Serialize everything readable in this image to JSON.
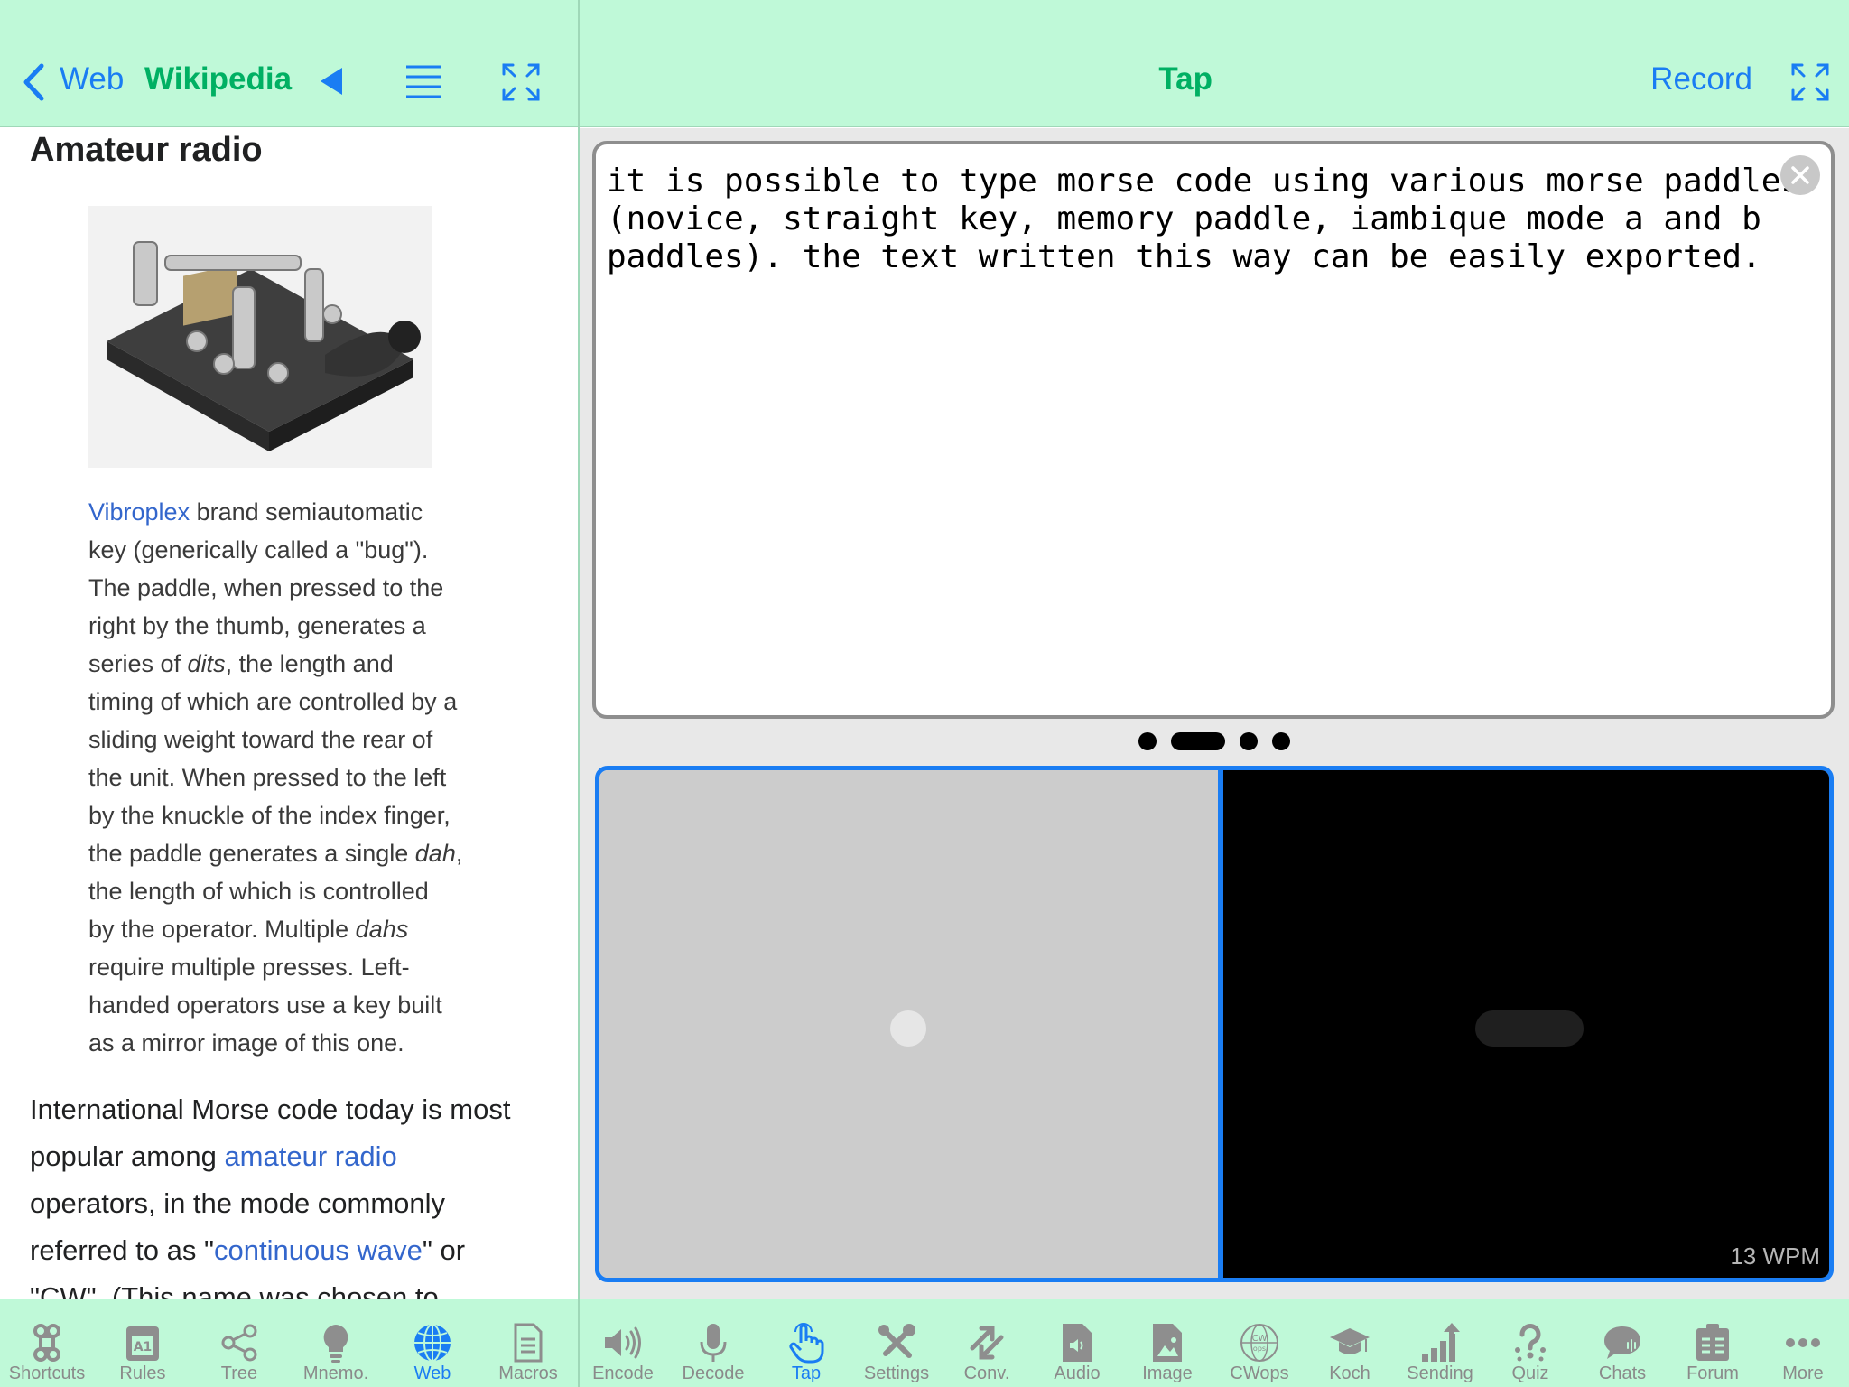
{
  "left_nav": {
    "back_label": "Web",
    "title": "Wikipedia"
  },
  "right_nav": {
    "title": "Tap",
    "record_label": "Record"
  },
  "article": {
    "heading": "Amateur radio",
    "caption_lines": [
      [
        "Vibroplex",
        " brand semiautomatic"
      ],
      [
        "key (generically called a \"bug\")."
      ],
      [
        "The paddle, when pressed to the"
      ],
      [
        "right by the thumb, generates a"
      ],
      [
        "series of ",
        "dits",
        ", the length and"
      ],
      [
        "timing of which are controlled by a"
      ],
      [
        "sliding weight toward the rear of"
      ],
      [
        "the unit. When pressed to the left"
      ],
      [
        "by the knuckle of the index finger,"
      ],
      [
        "the paddle generates a single ",
        "dah",
        ","
      ],
      [
        "the length of which is controlled"
      ],
      [
        "by the operator. Multiple ",
        "dahs"
      ],
      [
        "require multiple presses. Left-"
      ],
      [
        "handed operators use a key built"
      ],
      [
        "as a mirror image of this one."
      ]
    ],
    "body_lines": [
      [
        "International Morse code today is most"
      ],
      [
        "popular among ",
        "amateur radio"
      ],
      [
        "operators, in the mode commonly"
      ],
      [
        "referred to as \"",
        "continuous wave",
        "\" or"
      ],
      [
        "\"CW\". (This name was chosen to"
      ]
    ]
  },
  "tap": {
    "text_lines": [
      "it is possible to type morse code using various morse paddles",
      "(novice, straight key, memory paddle, iambique mode a and b",
      "paddles). the text written this way can be easily exported."
    ],
    "wpm": "13 WPM",
    "page_dots_count": 4,
    "active_dot": 1
  },
  "tabs": [
    {
      "label": "Shortcuts",
      "icon": "command-icon"
    },
    {
      "label": "Rules",
      "icon": "rules-icon"
    },
    {
      "label": "Tree",
      "icon": "share-tree-icon"
    },
    {
      "label": "Mnemo.",
      "icon": "lightbulb-icon"
    },
    {
      "label": "Web",
      "icon": "globe-icon",
      "active": true
    },
    {
      "label": "Macros",
      "icon": "document-icon"
    },
    {
      "label": "Encode",
      "icon": "speaker-icon"
    },
    {
      "label": "Decode",
      "icon": "microphone-icon"
    },
    {
      "label": "Tap",
      "icon": "hand-tap-icon",
      "active": true
    },
    {
      "label": "Settings",
      "icon": "tools-icon"
    },
    {
      "label": "Conv.",
      "icon": "convert-arrows-icon"
    },
    {
      "label": "Audio",
      "icon": "audio-file-icon"
    },
    {
      "label": "Image",
      "icon": "image-file-icon"
    },
    {
      "label": "CWops",
      "icon": "cwops-icon"
    },
    {
      "label": "Koch",
      "icon": "graduation-cap-icon"
    },
    {
      "label": "Sending",
      "icon": "bar-chart-icon"
    },
    {
      "label": "Quiz",
      "icon": "question-icon"
    },
    {
      "label": "Chats",
      "icon": "chat-bubble-icon"
    },
    {
      "label": "Forum",
      "icon": "forum-board-icon"
    },
    {
      "label": "More",
      "icon": "more-dots-icon"
    }
  ],
  "colors": {
    "bar_background": "#bff9d8",
    "accent_blue": "#1a7df3",
    "title_green": "#00b063",
    "link_blue": "#3366cc"
  }
}
